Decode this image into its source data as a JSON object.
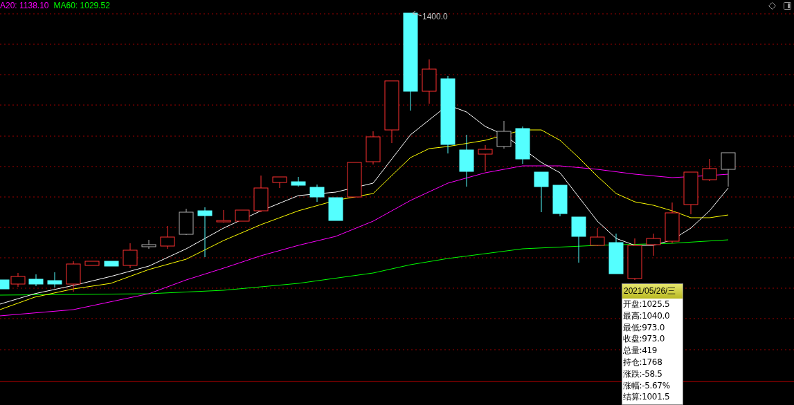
{
  "legend": [
    {
      "label": "A20: 1138.10",
      "color": "#ff00ff"
    },
    {
      "label": "MA60: 1029.52",
      "color": "#00ff00"
    }
  ],
  "chart": {
    "peak_label": "1400.0"
  },
  "tooltip": {
    "date": "2021/05/26/三",
    "rows": [
      "开盘:1025.5",
      "最高:1040.0",
      "最低:973.0",
      "收盘:973.0",
      "总量:419",
      "持仓:1768",
      "涨跌:-58.5",
      "涨幅:-5.67%",
      "结算:1001.5"
    ]
  }
}
